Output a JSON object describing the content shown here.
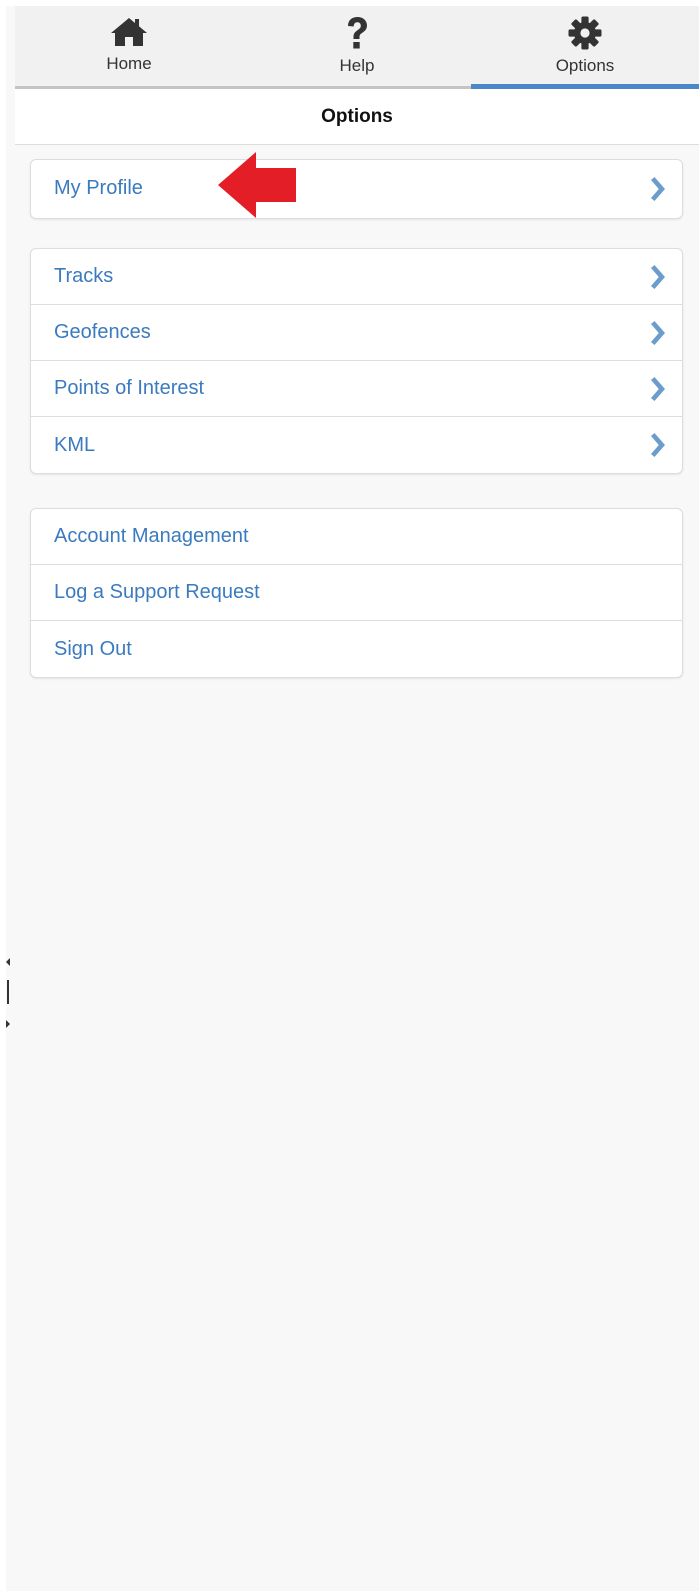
{
  "navbar": {
    "tabs": [
      {
        "label": "Home",
        "icon": "home-icon",
        "active": false
      },
      {
        "label": "Help",
        "icon": "question-icon",
        "active": false
      },
      {
        "label": "Options",
        "icon": "gear-icon",
        "active": true
      }
    ],
    "active_color": "#4a88c7"
  },
  "header": {
    "title": "Options"
  },
  "groups": {
    "profile": [
      {
        "label": "My Profile",
        "chevron": true
      }
    ],
    "data": [
      {
        "label": "Tracks",
        "chevron": true
      },
      {
        "label": "Geofences",
        "chevron": true
      },
      {
        "label": "Points of Interest",
        "chevron": true
      },
      {
        "label": "KML",
        "chevron": true
      }
    ],
    "account": [
      {
        "label": "Account Management",
        "chevron": false
      },
      {
        "label": "Log a Support Request",
        "chevron": false
      },
      {
        "label": "Sign Out",
        "chevron": false
      }
    ]
  },
  "colors": {
    "link": "#3a7bbf",
    "chevron": "#6b9ccc",
    "annotation_arrow": "#e41e26",
    "icon": "#333333"
  }
}
